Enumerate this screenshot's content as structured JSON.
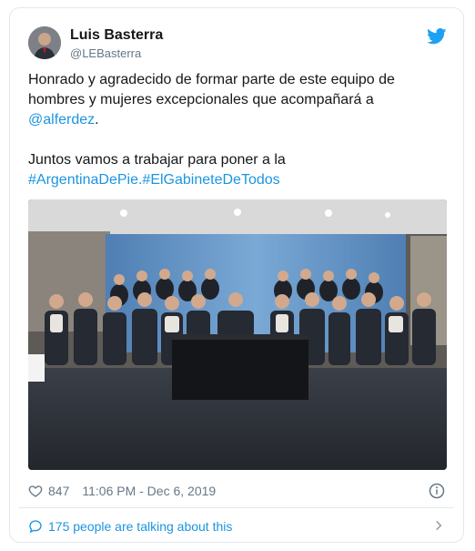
{
  "tweet": {
    "author_name": "Luis Basterra",
    "author_handle": "@LEBasterra",
    "lines": [
      "Honrado y agradecido de formar parte de este equipo de",
      "hombres y mujeres excepcionales que acompañará a"
    ],
    "mention": "@alferdez",
    "mention_suffix": ".",
    "line_juntos": "Juntos vamos a trabajar para poner a la",
    "hashtag_1": "#ArgentinaDePie",
    "hashtag_sep": ".",
    "hashtag_2": "#ElGabineteDeTodos",
    "likes": "847",
    "timestamp": "11:06 PM - Dec 6, 2019",
    "talking": "175 people are talking about this"
  },
  "colors": {
    "link": "#1b95e0",
    "muted": "#657786",
    "border": "#e1e8ed"
  },
  "icons": [
    "twitter-bird-icon",
    "heart-icon",
    "info-icon",
    "comment-bubble-icon",
    "chevron-right-icon"
  ]
}
